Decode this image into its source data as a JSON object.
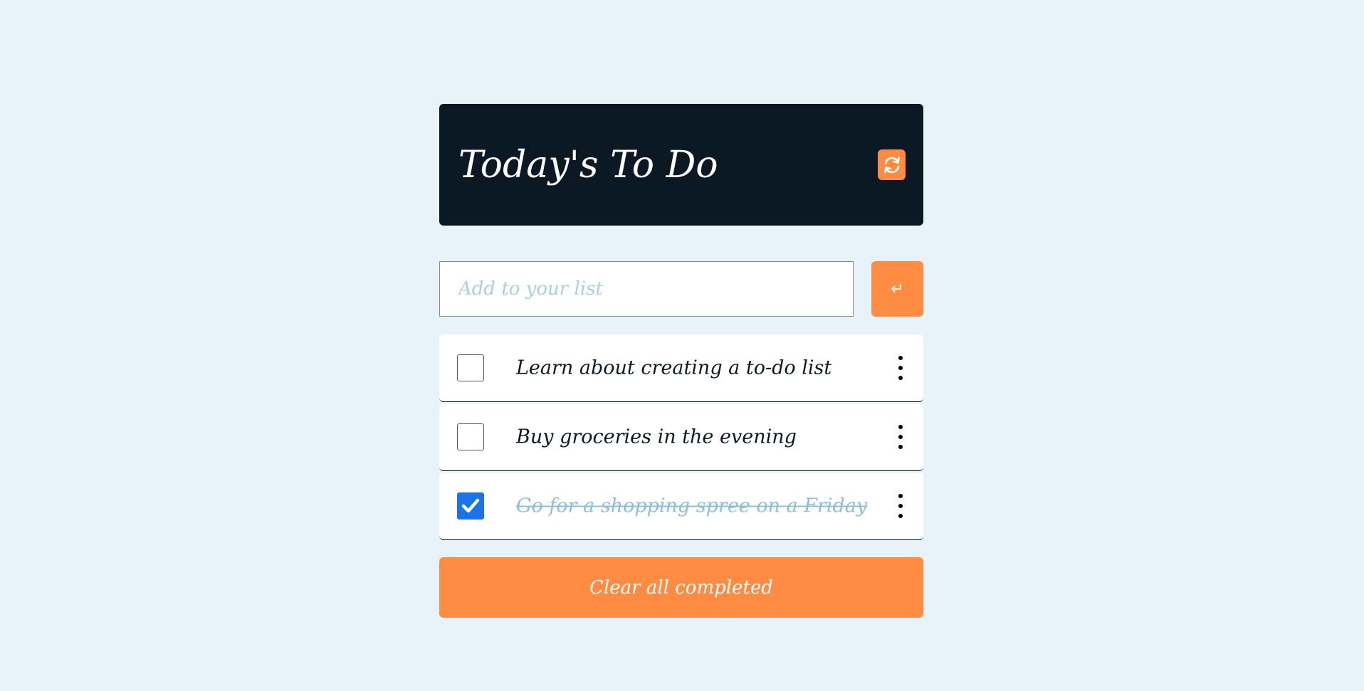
{
  "header": {
    "title": "Today's To Do",
    "refresh_icon": "refresh-icon"
  },
  "add": {
    "placeholder": "Add to your list",
    "value": "",
    "submit_icon": "enter-icon",
    "submit_glyph": "↵"
  },
  "items": [
    {
      "text": "Learn about creating a to-do list",
      "completed": false
    },
    {
      "text": "Buy groceries in the evening",
      "completed": false
    },
    {
      "text": "Go for a shopping spree on a Friday",
      "completed": true
    }
  ],
  "more_icon": "more-vertical-icon",
  "footer": {
    "clear_label": "Clear all completed"
  },
  "colors": {
    "background": "#e8f2f9",
    "header": "#0a1924",
    "accent": "#ff8c42",
    "checkbox_checked": "#1a73e8",
    "completed_text": "#8dbfd8"
  }
}
